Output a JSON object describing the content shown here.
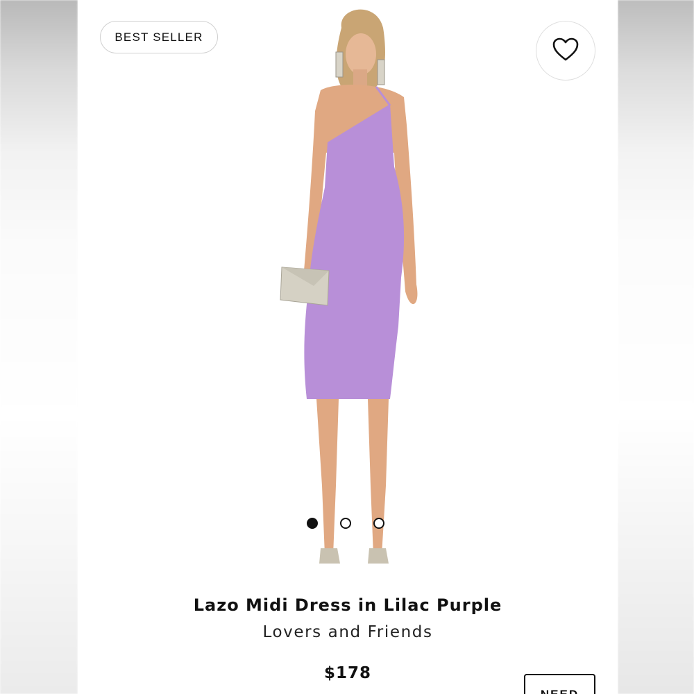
{
  "badge": {
    "label": "BEST SELLER"
  },
  "favorite": {
    "icon": "heart-outline-icon"
  },
  "carousel": {
    "count": 3,
    "active_index": 0
  },
  "product": {
    "name": "Lazo Midi Dress in Lilac Purple",
    "brand": "Lovers and Friends",
    "price": "$178",
    "dress_color": "#b88fd8"
  },
  "cta": {
    "label": "NEED"
  }
}
